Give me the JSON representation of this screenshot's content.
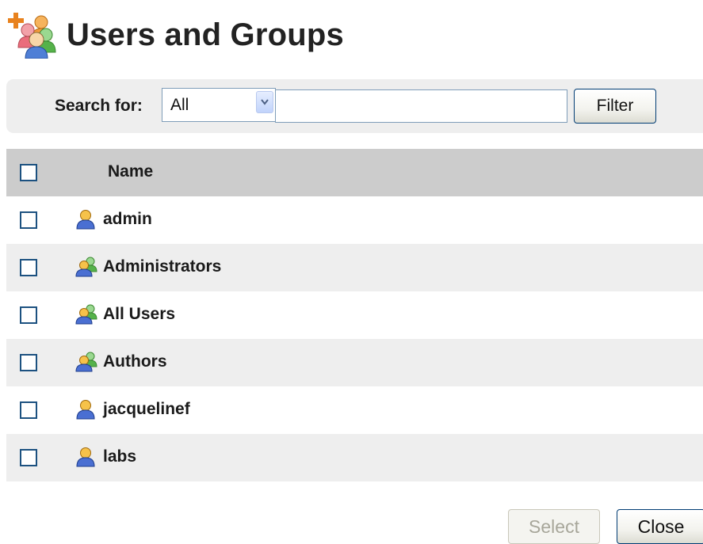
{
  "page": {
    "title": "Users and Groups",
    "title_icon": "users-groups-add-icon"
  },
  "search": {
    "label": "Search for:",
    "scope_selected": "All",
    "query_value": "",
    "filter_label": "Filter"
  },
  "table": {
    "header_label": "Name",
    "rows": [
      {
        "name": "admin",
        "kind": "user",
        "icon": "user-icon"
      },
      {
        "name": "Administrators",
        "kind": "group",
        "icon": "group-icon"
      },
      {
        "name": "All Users",
        "kind": "group",
        "icon": "group-icon"
      },
      {
        "name": "Authors",
        "kind": "group",
        "icon": "group-icon"
      },
      {
        "name": "jacquelinef",
        "kind": "user",
        "icon": "user-icon"
      },
      {
        "name": "labs",
        "kind": "user",
        "icon": "user-icon"
      }
    ]
  },
  "actions": {
    "select_label": "Select",
    "select_enabled": false,
    "close_label": "Close"
  },
  "colors": {
    "header_row": "#cccccc",
    "shaded_row": "#eeeeee",
    "checkbox_border": "#1c5180",
    "button_border": "#003c74"
  }
}
